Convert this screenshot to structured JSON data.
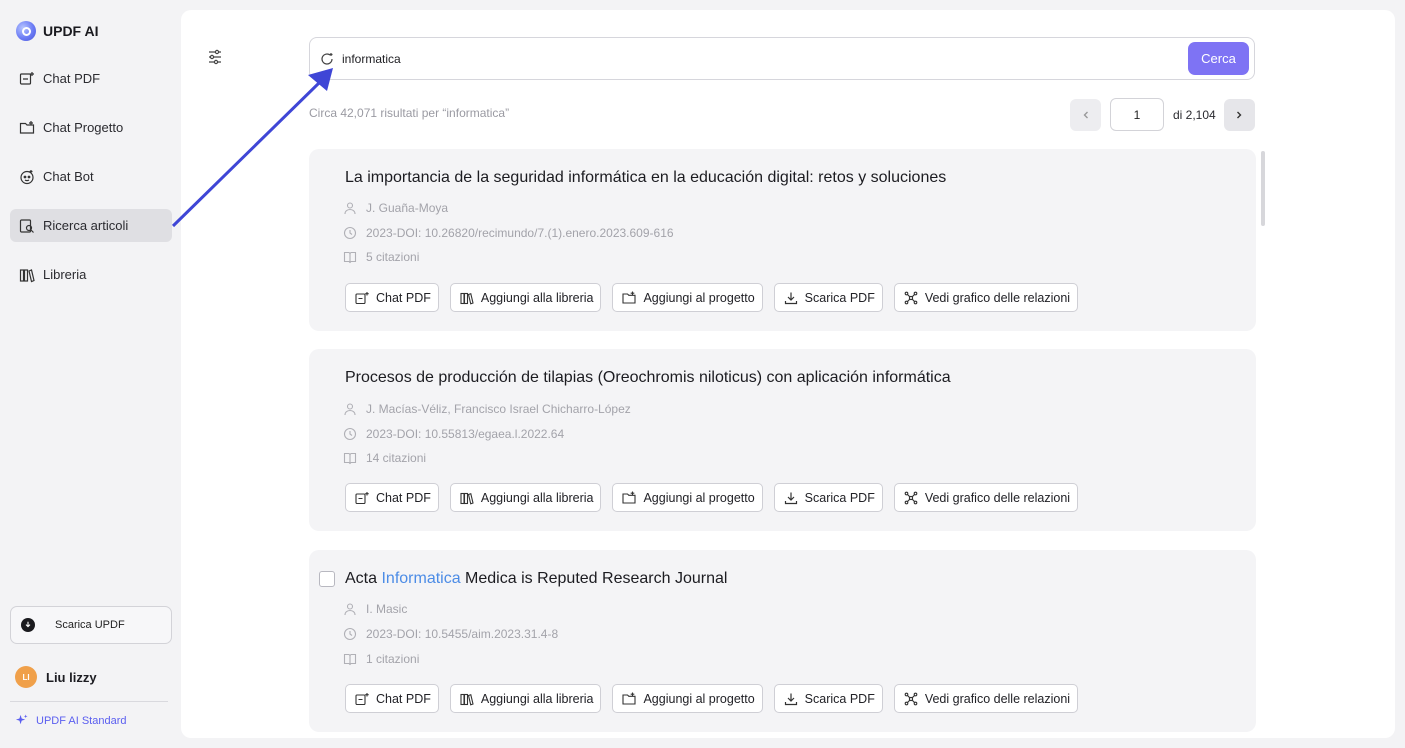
{
  "brand": {
    "name": "UPDF AI"
  },
  "sidebar": {
    "items": [
      {
        "label": "Chat PDF",
        "icon": "chat-pdf-icon"
      },
      {
        "label": "Chat Progetto",
        "icon": "folder-plus-icon"
      },
      {
        "label": "Chat Bot",
        "icon": "bot-icon"
      },
      {
        "label": "Ricerca articoli",
        "icon": "article-search-icon",
        "active": true
      },
      {
        "label": "Libreria",
        "icon": "library-icon"
      }
    ],
    "download_label": "Scarica UPDF",
    "user": {
      "initials": "LI",
      "name": "Liu lizzy"
    },
    "plan_label": "UPDF AI Standard"
  },
  "search": {
    "value": "informatica",
    "button_label": "Cerca"
  },
  "results": {
    "summary": "Circa 42,071 risultati per “informatica”"
  },
  "pager": {
    "current": "1",
    "total_label": "di 2,104"
  },
  "actions": {
    "chat_pdf": "Chat PDF",
    "add_library": "Aggiungi alla libreria",
    "add_project": "Aggiungi al progetto",
    "download_pdf": "Scarica PDF",
    "graph": "Vedi grafico delle relazioni"
  },
  "cards": [
    {
      "title": "La importancia de la seguridad informática en la educación digital: retos y soluciones",
      "authors": "J. Guaña-Moya",
      "doi": "2023-DOI: 10.26820/recimundo/7.(1).enero.2023.609-616",
      "citations": "5 citazioni"
    },
    {
      "title": "Procesos de producción de tilapias (Oreochromis niloticus) con aplicación informática",
      "authors": "J. Macías-Véliz,  Francisco Israel Chicharro-López",
      "doi": "2023-DOI: 10.55813/egaea.l.2022.64",
      "citations": "14 citazioni"
    },
    {
      "title_pre": "Acta ",
      "title_hl": "Informatica",
      "title_post": " Medica is Reputed Research Journal",
      "authors": "I. Masic",
      "doi": "2023-DOI: 10.5455/aim.2023.31.4-8",
      "citations": "1 citazioni"
    }
  ],
  "colors": {
    "accent": "#7e73f4",
    "highlight": "#4c8ce6",
    "annotation_arrow": "#3f46d6"
  }
}
